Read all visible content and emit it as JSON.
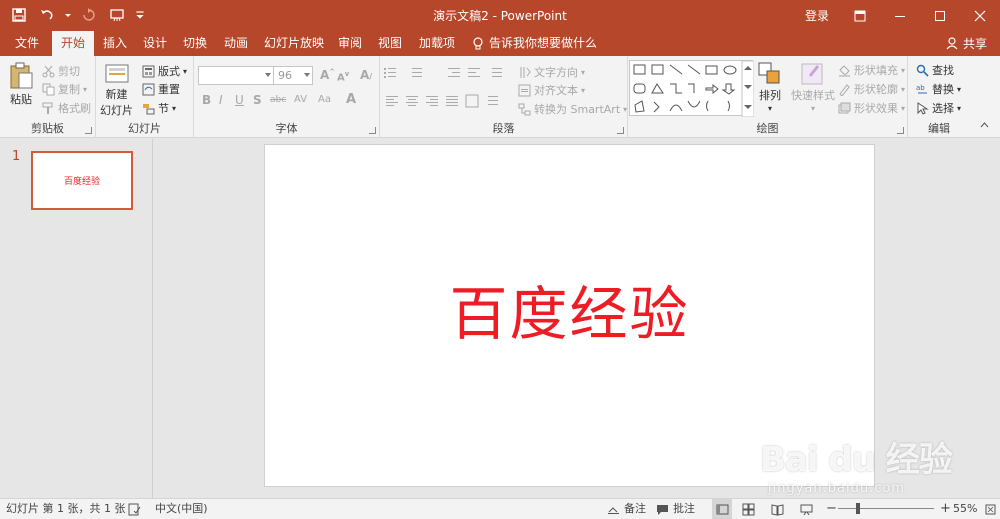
{
  "window": {
    "title": "演示文稿2  -  PowerPoint",
    "login": "登录"
  },
  "tabs": [
    {
      "label": "文件"
    },
    {
      "label": "开始"
    },
    {
      "label": "插入"
    },
    {
      "label": "设计"
    },
    {
      "label": "切换"
    },
    {
      "label": "动画"
    },
    {
      "label": "幻灯片放映"
    },
    {
      "label": "审阅"
    },
    {
      "label": "视图"
    },
    {
      "label": "加载项"
    }
  ],
  "active_tab": "开始",
  "tell_me": "告诉我你想要做什么",
  "share": "共享",
  "ribbon": {
    "clipboard": {
      "label": "剪贴板",
      "paste": "粘贴",
      "cut": "剪切",
      "copy": "复制",
      "format_painter": "格式刷"
    },
    "slides": {
      "label": "幻灯片",
      "new_slide_1": "新建",
      "new_slide_2": "幻灯片",
      "layout": "版式",
      "reset": "重置",
      "section": "节"
    },
    "font": {
      "label": "字体",
      "font_name": "",
      "font_size": "96"
    },
    "paragraph": {
      "label": "段落",
      "text_direction": "文字方向",
      "align_text": "对齐文本",
      "smartart": "转换为 SmartArt"
    },
    "drawing": {
      "label": "绘图",
      "arrange": "排列",
      "quick_styles": "快速样式",
      "shape_fill": "形状填充",
      "shape_outline": "形状轮廓",
      "shape_effects": "形状效果"
    },
    "editing": {
      "label": "编辑",
      "find": "查找",
      "replace": "替换",
      "select": "选择"
    }
  },
  "thumbnails": [
    {
      "number": "1",
      "text": "百度经验"
    }
  ],
  "slide": {
    "title": "百度经验"
  },
  "status": {
    "slide_info": "幻灯片 第 1 张，共 1 张",
    "language": "中文(中国)",
    "notes": "备注",
    "comments": "批注",
    "zoom": "55%",
    "zoom_fraction": 0.55
  },
  "watermark": {
    "brand": "Bai du 经验",
    "url": "jingyan.baidu.com"
  },
  "colors": {
    "accent": "#b7472a",
    "title_text": "#ee1c25"
  }
}
